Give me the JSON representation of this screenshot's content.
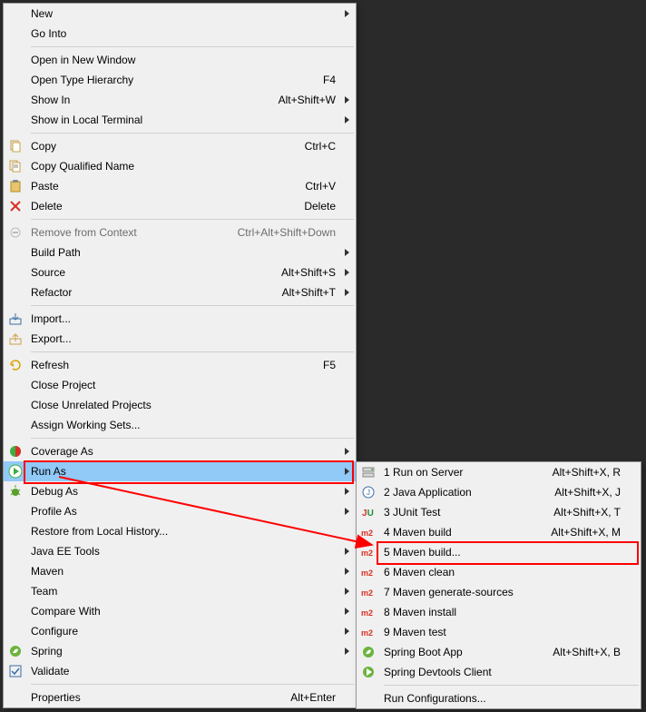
{
  "main_menu": {
    "groups": [
      [
        {
          "label": "New",
          "accel": "",
          "submenu": true,
          "icon": "blank",
          "name": "menu-new"
        },
        {
          "label": "Go Into",
          "accel": "",
          "submenu": false,
          "icon": "blank",
          "name": "menu-go-into"
        }
      ],
      [
        {
          "label": "Open in New Window",
          "accel": "",
          "submenu": false,
          "icon": "blank",
          "name": "menu-open-new-window"
        },
        {
          "label": "Open Type Hierarchy",
          "accel": "F4",
          "submenu": false,
          "icon": "blank",
          "name": "menu-open-type-hierarchy"
        },
        {
          "label": "Show In",
          "accel": "Alt+Shift+W",
          "submenu": true,
          "icon": "blank",
          "name": "menu-show-in"
        },
        {
          "label": "Show in Local Terminal",
          "accel": "",
          "submenu": true,
          "icon": "blank",
          "name": "menu-show-local-terminal"
        }
      ],
      [
        {
          "label": "Copy",
          "accel": "Ctrl+C",
          "submenu": false,
          "icon": "copy",
          "name": "menu-copy"
        },
        {
          "label": "Copy Qualified Name",
          "accel": "",
          "submenu": false,
          "icon": "copy-qn",
          "name": "menu-copy-qualified"
        },
        {
          "label": "Paste",
          "accel": "Ctrl+V",
          "submenu": false,
          "icon": "paste",
          "name": "menu-paste"
        },
        {
          "label": "Delete",
          "accel": "Delete",
          "submenu": false,
          "icon": "delete",
          "name": "menu-delete"
        }
      ],
      [
        {
          "label": "Remove from Context",
          "accel": "Ctrl+Alt+Shift+Down",
          "submenu": false,
          "icon": "remove-ctx",
          "disabled": true,
          "name": "menu-remove-context"
        },
        {
          "label": "Build Path",
          "accel": "",
          "submenu": true,
          "icon": "blank",
          "name": "menu-build-path"
        },
        {
          "label": "Source",
          "accel": "Alt+Shift+S",
          "submenu": true,
          "icon": "blank",
          "name": "menu-source"
        },
        {
          "label": "Refactor",
          "accel": "Alt+Shift+T",
          "submenu": true,
          "icon": "blank",
          "name": "menu-refactor"
        }
      ],
      [
        {
          "label": "Import...",
          "accel": "",
          "submenu": false,
          "icon": "import",
          "name": "menu-import"
        },
        {
          "label": "Export...",
          "accel": "",
          "submenu": false,
          "icon": "export",
          "name": "menu-export"
        }
      ],
      [
        {
          "label": "Refresh",
          "accel": "F5",
          "submenu": false,
          "icon": "refresh",
          "name": "menu-refresh"
        },
        {
          "label": "Close Project",
          "accel": "",
          "submenu": false,
          "icon": "blank",
          "name": "menu-close-project"
        },
        {
          "label": "Close Unrelated Projects",
          "accel": "",
          "submenu": false,
          "icon": "blank",
          "name": "menu-close-unrelated"
        },
        {
          "label": "Assign Working Sets...",
          "accel": "",
          "submenu": false,
          "icon": "blank",
          "name": "menu-assign-working-sets"
        }
      ],
      [
        {
          "label": "Coverage As",
          "accel": "",
          "submenu": true,
          "icon": "coverage",
          "name": "menu-coverage-as"
        },
        {
          "label": "Run As",
          "accel": "",
          "submenu": true,
          "icon": "run",
          "highlight": true,
          "redbox": true,
          "name": "menu-run-as"
        },
        {
          "label": "Debug As",
          "accel": "",
          "submenu": true,
          "icon": "debug",
          "name": "menu-debug-as"
        },
        {
          "label": "Profile As",
          "accel": "",
          "submenu": true,
          "icon": "blank",
          "name": "menu-profile-as"
        },
        {
          "label": "Restore from Local History...",
          "accel": "",
          "submenu": false,
          "icon": "blank",
          "name": "menu-restore-history"
        },
        {
          "label": "Java EE Tools",
          "accel": "",
          "submenu": true,
          "icon": "blank",
          "name": "menu-javaee-tools"
        },
        {
          "label": "Maven",
          "accel": "",
          "submenu": true,
          "icon": "blank",
          "name": "menu-maven"
        },
        {
          "label": "Team",
          "accel": "",
          "submenu": true,
          "icon": "blank",
          "name": "menu-team"
        },
        {
          "label": "Compare With",
          "accel": "",
          "submenu": true,
          "icon": "blank",
          "name": "menu-compare-with"
        },
        {
          "label": "Configure",
          "accel": "",
          "submenu": true,
          "icon": "blank",
          "name": "menu-configure"
        },
        {
          "label": "Spring",
          "accel": "",
          "submenu": true,
          "icon": "spring",
          "name": "menu-spring"
        },
        {
          "label": "Validate",
          "accel": "",
          "submenu": false,
          "icon": "validate",
          "name": "menu-validate"
        }
      ],
      [
        {
          "label": "Properties",
          "accel": "Alt+Enter",
          "submenu": false,
          "icon": "blank",
          "name": "menu-properties"
        }
      ]
    ]
  },
  "sub_menu": {
    "groups": [
      [
        {
          "label": "1 Run on Server",
          "accel": "Alt+Shift+X, R",
          "icon": "server",
          "name": "submenu-run-on-server"
        },
        {
          "label": "2 Java Application",
          "accel": "Alt+Shift+X, J",
          "icon": "java",
          "name": "submenu-java-application"
        },
        {
          "label": "3 JUnit Test",
          "accel": "Alt+Shift+X, T",
          "icon": "junit",
          "name": "submenu-junit-test"
        },
        {
          "label": "4 Maven build",
          "accel": "Alt+Shift+X, M",
          "icon": "m2",
          "name": "submenu-maven-build"
        },
        {
          "label": "5 Maven build...",
          "accel": "",
          "icon": "m2",
          "redbox": true,
          "name": "submenu-maven-build-dots"
        },
        {
          "label": "6 Maven clean",
          "accel": "",
          "icon": "m2",
          "name": "submenu-maven-clean"
        },
        {
          "label": "7 Maven generate-sources",
          "accel": "",
          "icon": "m2",
          "name": "submenu-maven-gensrc"
        },
        {
          "label": "8 Maven install",
          "accel": "",
          "icon": "m2",
          "name": "submenu-maven-install"
        },
        {
          "label": "9 Maven test",
          "accel": "",
          "icon": "m2",
          "name": "submenu-maven-test"
        },
        {
          "label": "Spring Boot App",
          "accel": "Alt+Shift+X, B",
          "icon": "spring",
          "name": "submenu-spring-boot"
        },
        {
          "label": "Spring Devtools Client",
          "accel": "",
          "icon": "spring-dev",
          "name": "submenu-spring-devtools"
        }
      ],
      [
        {
          "label": "Run Configurations...",
          "accel": "",
          "icon": "blank",
          "name": "submenu-run-config"
        }
      ]
    ]
  }
}
